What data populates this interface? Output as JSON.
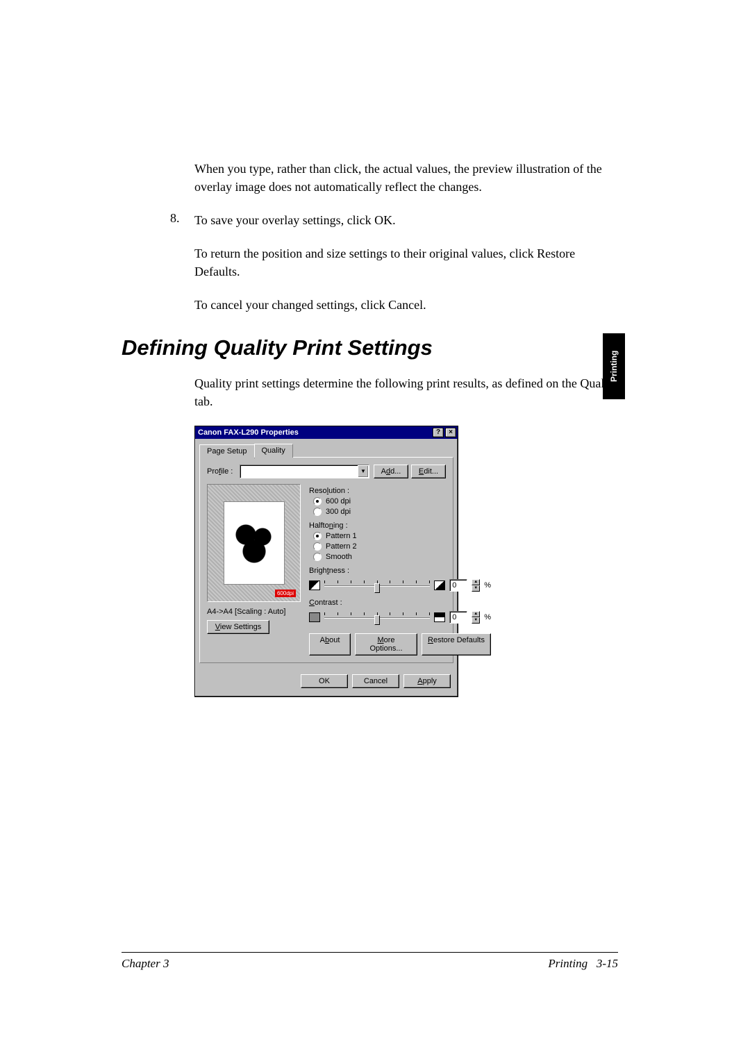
{
  "sideTab": "Printing",
  "para1": "When you type, rather than click, the actual values, the preview illustration of the overlay image does not automatically reflect the changes.",
  "step8num": "8.",
  "step8": "To save your overlay settings, click OK.",
  "step8a": "To return the position and size settings to their original values, click Restore Defaults.",
  "step8b": "To cancel your changed settings, click Cancel.",
  "heading": "Defining Quality Print Settings",
  "intro": "Quality print settings determine the following print results, as defined on the Quality tab.",
  "dialog": {
    "title": "Canon FAX-L290 Properties",
    "helpBtn": "?",
    "closeBtn": "×",
    "tabs": {
      "pageSetup": "Page Setup",
      "quality": "Quality"
    },
    "profileLabelPre": "Pro",
    "profileLabelU": "f",
    "profileLabelPost": "ile :",
    "addPre": "A",
    "addU": "d",
    "addPost": "d...",
    "editU": "E",
    "editPost": "dit...",
    "resolution": {
      "labelPre": "Reso",
      "labelU": "l",
      "labelPost": "ution :",
      "opt600": "600 dpi",
      "opt300": "300 dpi"
    },
    "halftoning": {
      "labelPre": "Halfto",
      "labelU": "n",
      "labelPost": "ing :",
      "p1": "Pattern 1",
      "p2": "Pattern 2",
      "smooth": "Smooth"
    },
    "brightness": {
      "labelPre": "Brigh",
      "labelU": "t",
      "labelPost": "ness :",
      "value": "0",
      "unit": "%"
    },
    "contrast": {
      "labelU": "C",
      "labelPost": "ontrast :",
      "value": "0",
      "unit": "%"
    },
    "dpiBadge": "600dpi",
    "scaling": "A4->A4 [Scaling : Auto]",
    "viewU": "V",
    "viewPost": "iew Settings",
    "aboutPre": "A",
    "aboutU": "b",
    "aboutPost": "out",
    "moreU": "M",
    "morePost": "ore Options...",
    "restoreU": "R",
    "restorePost": "estore Defaults",
    "ok": "OK",
    "cancel": "Cancel",
    "applyU": "A",
    "applyPost": "pply"
  },
  "footer": {
    "left": "Chapter 3",
    "rightLabel": "Printing",
    "rightPage": "3-15"
  }
}
